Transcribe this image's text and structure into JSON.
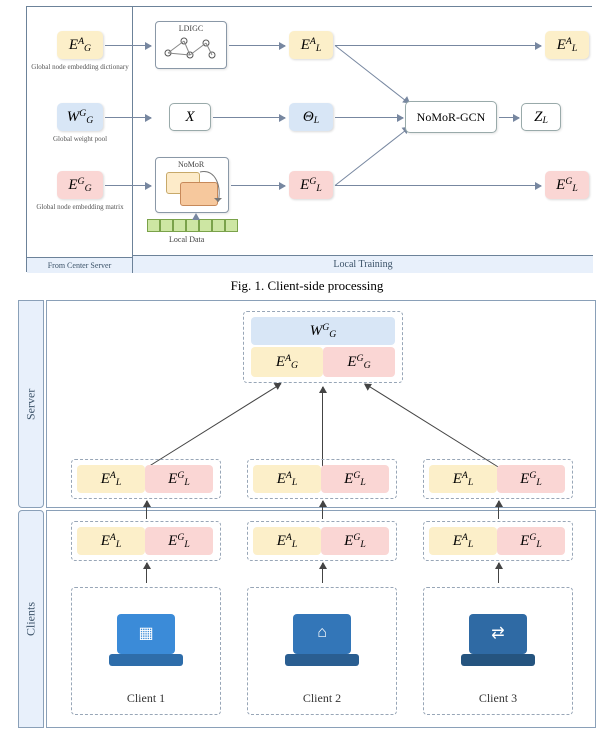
{
  "fig1": {
    "left_panel_label": "From Center Server",
    "right_panel_label": "Local Training",
    "inputs": [
      {
        "sym": "E",
        "sub": "G",
        "sup": "A",
        "color": "yellow",
        "desc": "Global node embedding dictionary"
      },
      {
        "sym": "W",
        "sub": "G",
        "sup": "G",
        "color": "blue",
        "desc": "Global weight pool"
      },
      {
        "sym": "E",
        "sub": "G",
        "sup": "G",
        "color": "pink",
        "desc": "Global node embedding matrix"
      }
    ],
    "processors": {
      "ldigc": "LDIGC",
      "x": "X",
      "nomor": "NoMoR",
      "local_data": "Local Data"
    },
    "mids": [
      {
        "sym": "E",
        "sub": "L",
        "sup": "A",
        "color": "yellow"
      },
      {
        "sym": "Θ",
        "sub": "L",
        "sup": "",
        "color": "blue"
      },
      {
        "sym": "E",
        "sub": "L",
        "sup": "G",
        "color": "pink"
      }
    ],
    "nomor_gcn": "NoMoR-GCN",
    "z": {
      "sym": "Z",
      "sub": "L",
      "sup": ""
    },
    "outputs": [
      {
        "sym": "E",
        "sub": "L",
        "sup": "A",
        "color": "yellow"
      },
      {
        "sym": "E",
        "sub": "L",
        "sup": "G",
        "color": "pink"
      }
    ]
  },
  "caption1": "Fig. 1.   Client-side processing",
  "fig2": {
    "server_label": "Server",
    "clients_label": "Clients",
    "server_top": {
      "sym": "W",
      "sub": "G",
      "sup": "G"
    },
    "server_pair": {
      "left": {
        "sym": "E",
        "sub": "G",
        "sup": "A"
      },
      "right": {
        "sym": "E",
        "sub": "G",
        "sup": "G"
      }
    },
    "rows": [
      {
        "left": {
          "sym": "E",
          "sub": "L",
          "sup": "A"
        },
        "right": {
          "sym": "E",
          "sub": "L",
          "sup": "G"
        }
      },
      {
        "left": {
          "sym": "E",
          "sub": "L",
          "sup": "A"
        },
        "right": {
          "sym": "E",
          "sub": "L",
          "sup": "G"
        }
      },
      {
        "left": {
          "sym": "E",
          "sub": "L",
          "sup": "A"
        },
        "right": {
          "sym": "E",
          "sub": "L",
          "sup": "G"
        }
      }
    ],
    "clients": [
      "Client 1",
      "Client 2",
      "Client 3"
    ]
  }
}
